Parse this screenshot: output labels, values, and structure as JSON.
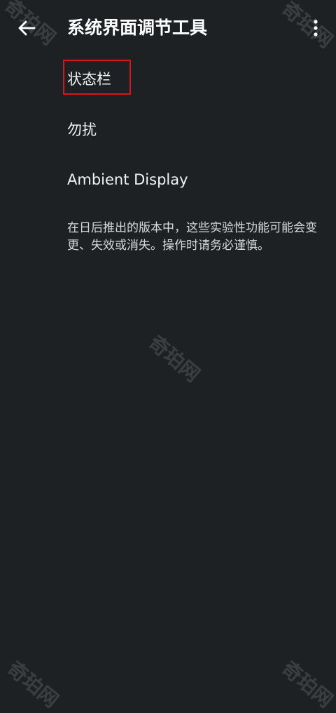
{
  "app_bar": {
    "title": "系统界面调节工具",
    "back_icon": "arrow-left-icon",
    "overflow_icon": "more-vert-icon"
  },
  "items": [
    {
      "label": "状态栏"
    },
    {
      "label": "勿扰"
    },
    {
      "label": "Ambient Display"
    }
  ],
  "footer_note": "在日后推出的版本中，这些实验性功能可能会变更、失效或消失。操作时请务必谨慎。",
  "watermark": "奇珀网",
  "colors": {
    "background": "#1e2124",
    "highlight": "#d8151b"
  }
}
